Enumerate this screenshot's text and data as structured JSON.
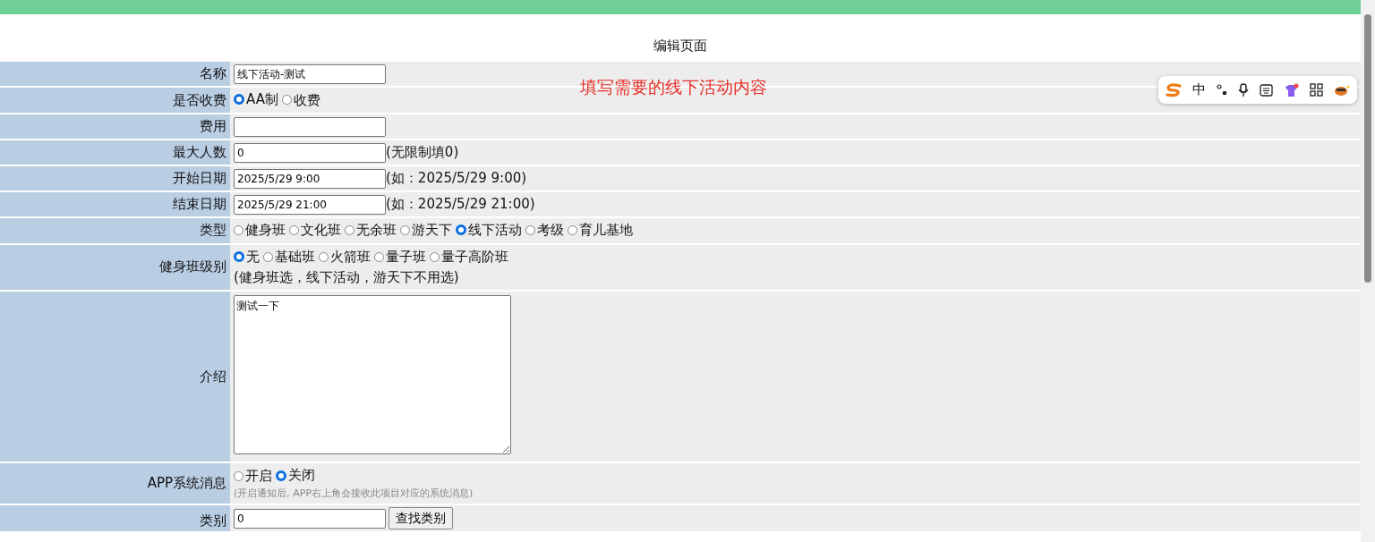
{
  "page_title": "编辑页面",
  "hint": "填写需要的线下活动内容",
  "ime_toolbar": {
    "mode": "中"
  },
  "form": [
    {
      "label": "名称",
      "kind": "input",
      "value": "线下活动-测试"
    },
    {
      "label": "是否收费",
      "kind": "radio",
      "options": [
        {
          "label": "AA制",
          "selected": true
        },
        {
          "label": "收费",
          "selected": false
        }
      ]
    },
    {
      "label": "费用",
      "kind": "input"
    },
    {
      "label": "最大人数",
      "kind": "input",
      "value": "0",
      "note": "(无限制填0)"
    },
    {
      "label": "开始日期",
      "kind": "input",
      "value": "2025/5/29 9:00",
      "note": "(如：2025/5/29 9:00)"
    },
    {
      "label": "结束日期",
      "kind": "input",
      "value": "2025/5/29 21:00",
      "note": "(如：2025/5/29 21:00)"
    },
    {
      "label": "类型",
      "kind": "radio",
      "options": [
        {
          "label": "健身班",
          "selected": false
        },
        {
          "label": "文化班",
          "selected": false
        },
        {
          "label": "无余班",
          "selected": false
        },
        {
          "label": "游天下",
          "selected": false
        },
        {
          "label": "线下活动",
          "selected": true
        },
        {
          "label": "考级",
          "selected": false
        },
        {
          "label": "育儿基地",
          "selected": false
        }
      ]
    },
    {
      "label": "健身班级别",
      "kind": "radio",
      "options": [
        {
          "label": "无",
          "selected": true
        },
        {
          "label": "基础班",
          "selected": false
        },
        {
          "label": "火箭班",
          "selected": false
        },
        {
          "label": "量子班",
          "selected": false
        },
        {
          "label": "量子高阶班",
          "selected": false
        }
      ],
      "note": "(健身班选，线下活动，游天下不用选)"
    },
    {
      "label": "介绍",
      "kind": "textarea",
      "value": "测试一下"
    },
    {
      "label": "APP系统消息",
      "kind": "radio",
      "options": [
        {
          "label": "开启",
          "selected": false
        },
        {
          "label": "关闭",
          "selected": true
        }
      ],
      "small_note": "(开启通知后, APP右上角会接收此项目对应的系统消息)"
    },
    {
      "label": "类别",
      "kind": "lookup",
      "value": "0",
      "button": "查找类别"
    }
  ]
}
